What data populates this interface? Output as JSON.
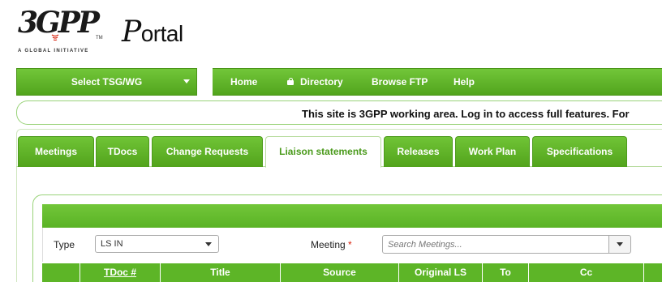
{
  "logo": {
    "text": "3GPP",
    "tagline": "A GLOBAL INITIATIVE",
    "tm": "TM"
  },
  "portal_logo": {
    "first": "P",
    "rest": "ortal"
  },
  "nav": {
    "select_label": "Select TSG/WG",
    "items": [
      {
        "label": "Home"
      },
      {
        "label": "Directory",
        "icon": "lock-icon"
      },
      {
        "label": "Browse FTP"
      },
      {
        "label": "Help"
      }
    ]
  },
  "notice": "This site is 3GPP working area. Log in to access full features. For",
  "tabs": [
    {
      "label": "Meetings",
      "active": false
    },
    {
      "label": "TDocs",
      "active": false
    },
    {
      "label": "Change Requests",
      "active": false
    },
    {
      "label": "Liaison statements",
      "active": true
    },
    {
      "label": "Releases",
      "active": false
    },
    {
      "label": "Work Plan",
      "active": false
    },
    {
      "label": "Specifications",
      "active": false
    }
  ],
  "filters": {
    "type_label": "Type",
    "type_value": "LS IN",
    "meeting_label": "Meeting",
    "meeting_required": "*",
    "meeting_placeholder": "Search Meetings..."
  },
  "table": {
    "columns": [
      "",
      "TDoc #",
      "Title",
      "Source",
      "Original LS",
      "To",
      "Cc",
      ""
    ]
  },
  "colors": {
    "brand_green": "#5db527",
    "required": "#d9230f"
  }
}
